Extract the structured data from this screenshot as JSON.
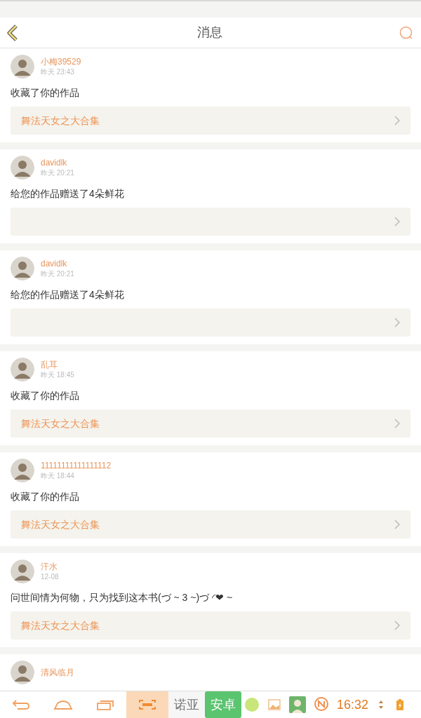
{
  "header": {
    "title": "消息"
  },
  "messages": [
    {
      "user": "小梅39529",
      "time": "昨天 23:43",
      "text": "收藏了你的作品",
      "work": "舞法天女之大合集"
    },
    {
      "user": "davidlk",
      "time": "昨天 20:21",
      "text": "给您的作品赠送了4朵鲜花"
    },
    {
      "user": "davidlk",
      "time": "昨天 20:21",
      "text": "给您的作品赠送了4朵鲜花"
    },
    {
      "user": "乱耳",
      "time": "昨天 18:45",
      "text": "收藏了你的作品",
      "work": "舞法天女之大合集"
    },
    {
      "user": "11111111111111112",
      "time": "昨天 18:44",
      "text": "收藏了你的作品",
      "work": "舞法天女之大合集"
    },
    {
      "user": "汗水",
      "time": "12-08",
      "text": "问世间情为何物，只为找到这本书(づ ~ 3 ~)づ ◜❤ ~",
      "work": "舞法天女之大合集"
    },
    {
      "user": "清风临月"
    }
  ],
  "navbar": {
    "buttons": [
      {
        "kind": "back",
        "selected": false
      },
      {
        "kind": "home",
        "selected": false
      },
      {
        "kind": "recent",
        "selected": false
      },
      {
        "kind": "screenshot",
        "selected": true
      }
    ],
    "labels": [
      "诺亚",
      "安卓"
    ],
    "time": "16:32"
  }
}
